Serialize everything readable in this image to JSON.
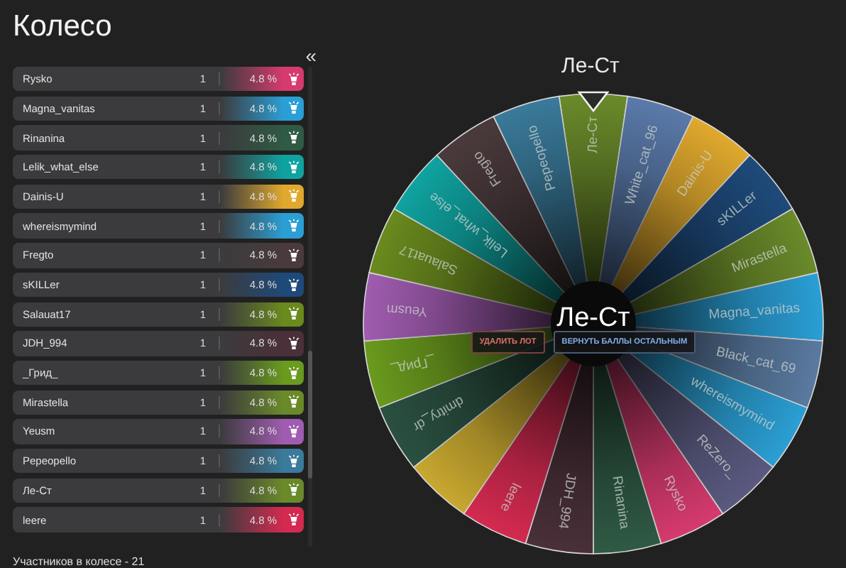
{
  "title": "Колесо",
  "collapse_button": "«",
  "participants": [
    {
      "name": "Rysko",
      "count": "1",
      "percent": "4.8 %",
      "color": "#d63a6e"
    },
    {
      "name": "Magna_vanitas",
      "count": "1",
      "percent": "4.8 %",
      "color": "#2a9fd6"
    },
    {
      "name": "Rinanina",
      "count": "1",
      "percent": "4.8 %",
      "color": "#2f5a44"
    },
    {
      "name": "Lelik_what_else",
      "count": "1",
      "percent": "4.8 %",
      "color": "#0fa3a0"
    },
    {
      "name": "Dainis-U",
      "count": "1",
      "percent": "4.8 %",
      "color": "#e0a92e"
    },
    {
      "name": "whereismymind",
      "count": "1",
      "percent": "4.8 %",
      "color": "#2b9fd4"
    },
    {
      "name": "Fregto",
      "count": "1",
      "percent": "4.8 %",
      "color": "#4a3a3c"
    },
    {
      "name": "sKILLer",
      "count": "1",
      "percent": "4.8 %",
      "color": "#1e4a7a"
    },
    {
      "name": "Salauat17",
      "count": "1",
      "percent": "4.8 %",
      "color": "#6a8a1e"
    },
    {
      "name": "JDH_994",
      "count": "1",
      "percent": "4.8 %",
      "color": "#4a3038"
    },
    {
      "name": "_Грид_",
      "count": "1",
      "percent": "4.8 %",
      "color": "#6a9a1e"
    },
    {
      "name": "Mirastella",
      "count": "1",
      "percent": "4.8 %",
      "color": "#6a8a2a"
    },
    {
      "name": "Yeusm",
      "count": "1",
      "percent": "4.8 %",
      "color": "#a05cb0"
    },
    {
      "name": "Pepeopello",
      "count": "1",
      "percent": "4.8 %",
      "color": "#3a7a9a"
    },
    {
      "name": "Ле-Ст",
      "count": "1",
      "percent": "4.8 %",
      "color": "#6a8a2a"
    },
    {
      "name": "leere",
      "count": "1",
      "percent": "4.8 %",
      "color": "#d42a50"
    }
  ],
  "footer": "Участников в колесе - 21",
  "wheel": {
    "winner_title": "Ле-Ст",
    "center_label": "Ле-Ст",
    "segments": [
      {
        "label": "Ле-Ст",
        "color": "#6a8a2a"
      },
      {
        "label": "White_cat_96",
        "color": "#5a7aaa"
      },
      {
        "label": "Dainis-U",
        "color": "#e0a92e"
      },
      {
        "label": "sKILLer",
        "color": "#1e4a7a"
      },
      {
        "label": "Mirastella",
        "color": "#6a8a2a"
      },
      {
        "label": "Magna_vanitas",
        "color": "#2a9fd6"
      },
      {
        "label": "Black_cat_69",
        "color": "#5a7aa0"
      },
      {
        "label": "whereismymind",
        "color": "#2b9fd4"
      },
      {
        "label": "ReZero_",
        "color": "#5a5a80"
      },
      {
        "label": "Rysko",
        "color": "#d63a6e"
      },
      {
        "label": "Rinanina",
        "color": "#2f5a44"
      },
      {
        "label": "JDH_994",
        "color": "#4a3038"
      },
      {
        "label": "leere",
        "color": "#d42a50"
      },
      {
        "color": "#c8a830"
      },
      {
        "label": "dmitry_dr",
        "color": "#2a5040"
      },
      {
        "label": "_Грид_",
        "color": "#6a9a1e"
      },
      {
        "label": "Yeusm",
        "color": "#a05cb0"
      },
      {
        "label": "Salauat17",
        "color": "#6a8a1e"
      },
      {
        "label": "Lelik_what_else",
        "color": "#0fa3a0"
      },
      {
        "label": "Fregto",
        "color": "#4a3a3c"
      },
      {
        "label": "Pepeopello",
        "color": "#3a7a9a"
      }
    ],
    "buttons": [
      {
        "label": "УДАЛИТЬ ЛОТ",
        "kind": "danger"
      },
      {
        "label": "ВЕРНУТЬ БАЛЛЫ ОСТАЛЬНЫМ",
        "kind": "primary"
      }
    ]
  }
}
